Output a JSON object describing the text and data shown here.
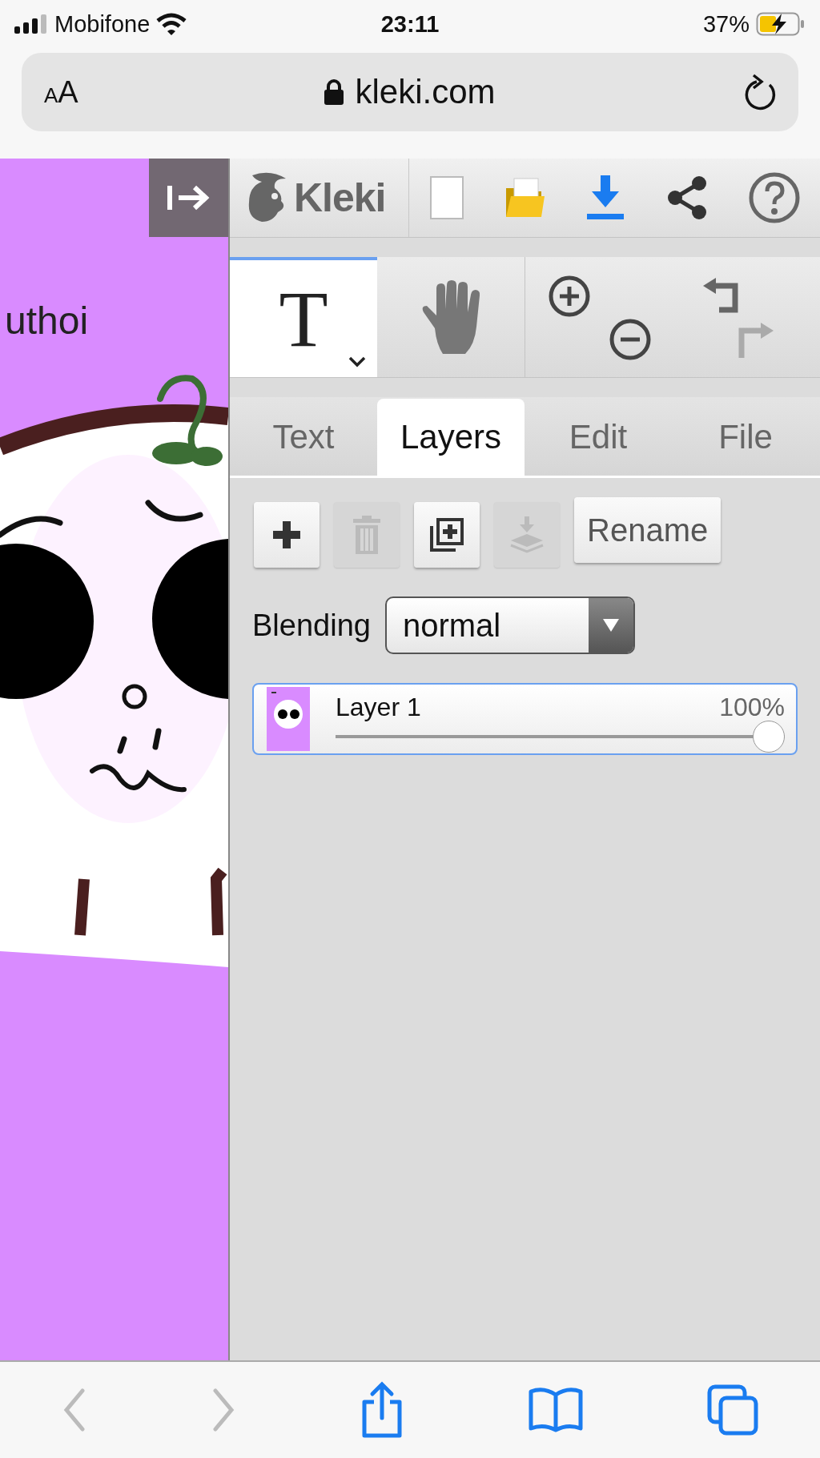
{
  "status_bar": {
    "carrier": "Mobifone",
    "time": "23:11",
    "battery": "37%"
  },
  "address_bar": {
    "text_size": "AA",
    "url": "kleki.com"
  },
  "canvas": {
    "text": "uthoi"
  },
  "toolbar": {
    "logo": "Kleki"
  },
  "tools": [
    {
      "kind": "text",
      "icon": "T",
      "selected": true
    },
    {
      "kind": "hand",
      "selected": false
    }
  ],
  "history": [
    {
      "kind": "undo",
      "disabled": false
    },
    {
      "kind": "redo",
      "disabled": true
    }
  ],
  "tabs": [
    {
      "label": "Text",
      "selected": false
    },
    {
      "label": "Layers",
      "selected": true
    },
    {
      "label": "Edit",
      "selected": false
    },
    {
      "label": "File",
      "selected": false
    }
  ],
  "layer_actions": [
    {
      "kind": "add",
      "disabled": false
    },
    {
      "kind": "delete",
      "disabled": true
    },
    {
      "kind": "duplicate",
      "disabled": false
    },
    {
      "kind": "merge",
      "disabled": true
    }
  ],
  "rename_button": "Rename",
  "blending": {
    "label": "Blending",
    "value": "normal"
  },
  "layers": [
    {
      "name": "Layer 1",
      "opacity": "100%",
      "level": 1,
      "selected": true
    }
  ],
  "browser_nav": [
    {
      "kind": "back",
      "disabled": true
    },
    {
      "kind": "forward",
      "disabled": true
    }
  ]
}
